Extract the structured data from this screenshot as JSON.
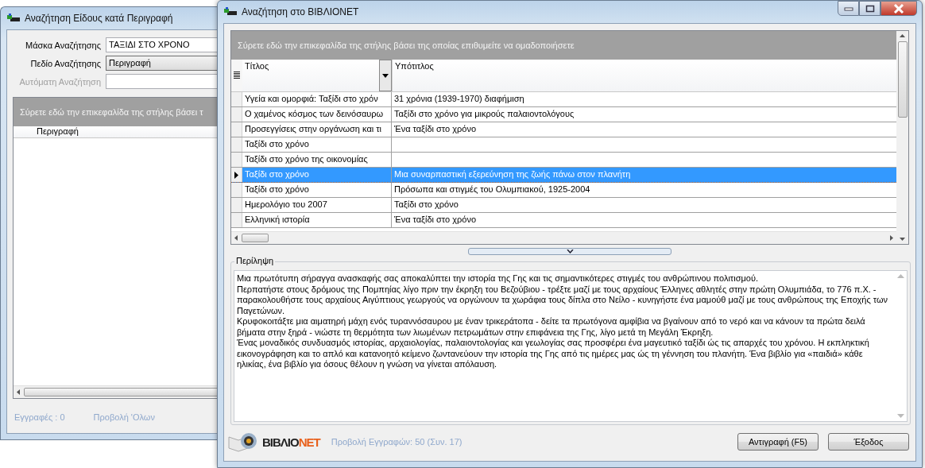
{
  "search_window": {
    "title": "Αναζήτηση Είδους κατά Περιγραφή",
    "fields": [
      {
        "label": "Μάσκα Αναζήτησης",
        "kind": "text",
        "value": "ΤΑΞΙΔΙ ΣΤΟ ΧΡΟΝΟ",
        "disabled": false
      },
      {
        "label": "Πεδίο Αναζήτησης",
        "kind": "select",
        "value": "Περιγραφή",
        "disabled": false
      },
      {
        "label": "Αυτόματη Αναζήτηση",
        "kind": "text",
        "disabled": true
      }
    ],
    "group_hint": "Σύρετε εδώ την επικεφαλίδα της στήλης βάσει τ",
    "columns": [
      "Περιγραφή"
    ],
    "records": "Εγγραφές : 0",
    "show_all": "Προβολή 'Ολων"
  },
  "main_window": {
    "title": "Αναζήτηση στο ΒΙΒΛΙΟΝΕΤ",
    "group_hint": "Σύρετε εδώ την επικεφαλίδα της στήλης βάσει της οποίας επιθυμείτε να ομαδοποιήσετε",
    "columns": [
      "Τίτλος",
      "Υπότιτλος"
    ],
    "rows": [
      {
        "title": "Υγεία και ομορφιά: Ταξίδι στο χρόν",
        "subtitle": "31 χρόνια (1939-1970) διαφήμιση",
        "selected": false
      },
      {
        "title": "Ο χαμένος κόσμος των δεινόσαυρω",
        "subtitle": "Ταξίδι στο χρόνο για μικρούς παλαιοντολόγους",
        "selected": false
      },
      {
        "title": "Προσεγγίσεις στην οργάνωση και τι",
        "subtitle": "Ένα ταξίδι στο χρόνο",
        "selected": false
      },
      {
        "title": "Ταξίδι στο χρόνο",
        "selected": false
      },
      {
        "title": "Ταξίδι στο χρόνο της οικονομίας",
        "selected": false
      },
      {
        "title": "Ταξίδι στο χρόνο",
        "subtitle": "Μια συναρπαστική εξερεύνηση της ζωής πάνω στον πλανήτη",
        "selected": true
      },
      {
        "title": "Ταξίδι στο χρόνο",
        "subtitle": "Πρόσωπα και στιγμές του Ολυμπιακού, 1925-2004",
        "selected": false
      },
      {
        "title": "Ημερολόγιο του 2007",
        "subtitle": "Ταξίδι στο χρόνο",
        "selected": false
      },
      {
        "title": "Ελληνική ιστορία",
        "subtitle": "Ένα ταξίδι στο χρόνο",
        "selected": false
      }
    ],
    "summary_label": "Περίληψη",
    "summary": "Μια πρωτότυπη σήραγγα ανασκαφής σας αποκαλύπτει την ιστορία της Γης και τις σημαντικότερες στιγμές του ανθρώπινου πολιτισμού.\nΠερπατήστε στους δρόμους της Πομπηίας λίγο πριν την έκρηξη του Βεζούβιου - τρέξτε μαζί με τους αρχαίους Έλληνες αθλητές στην πρώτη Ολυμπιάδα, το 776 π.Χ. - παρακολουθήστε τους αρχαίους Αιγύπτιους γεωργούς να οργώνουν τα χωράφια τους δίπλα στο Νείλο - κυνηγήστε ένα μαμούθ μαζί με τους ανθρώπους της Εποχής των Παγετώνων.\nΚρυφοκοιτάξτε μια αιματηρή μάχη ενός τυραννόσαυρου με έναν τρικεράτοπα - δείτε τα πρωτόγονα αμφίβια να βγαίνουν από το νερό και να κάνουν τα πρώτα δειλά βήματα στην ξηρά - νιώστε τη θερμότητα των λιωμένων πετρωμάτων στην επιφάνεια της Γης, λίγο μετά τη Μεγάλη Έκρηξη.\nΈνας μοναδικός συνδυασμός ιστορίας, αρχαιολογίας, παλαιοντολογίας και γεωλογίας σας προσφέρει ένα μαγευτικό ταξίδι ώς τις απαρχές του χρόνου. Η εκπληκτική εικονογράφηση και το απλό και κατανοητό κείμενο ζωντανεύουν την ιστορία της Γης από τις ημέρες μας ώς τη γέννηση του πλανήτη. Ένα βιβλίο για «παιδιά» κάθε ηλικίας, ένα βιβλίο για όσους θέλουν η γνώση να γίνεται απόλαυση.",
    "logo": {
      "prefix": "ΒΙΒΛΙΟ",
      "suffix": "NET"
    },
    "record_count": "Προβολή Εγγραφών: 50 (Συν. 17)",
    "buttons": [
      "Αντιγραφή (F5)",
      "Έξοδος"
    ]
  }
}
